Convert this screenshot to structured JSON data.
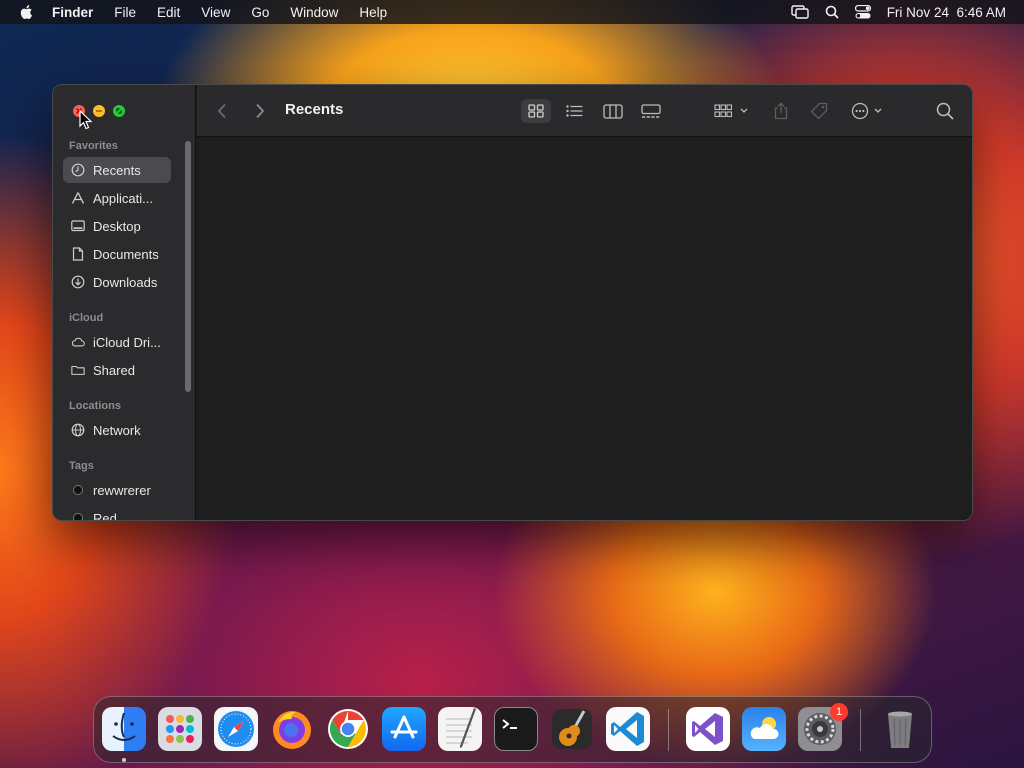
{
  "menubar": {
    "app_name": "Finder",
    "menus": [
      "File",
      "Edit",
      "View",
      "Go",
      "Window",
      "Help"
    ],
    "clock": "Fri Nov 24  6:46 AM",
    "icons": [
      "screen-mirroring-icon",
      "spotlight-search-icon",
      "control-center-icon"
    ]
  },
  "window": {
    "title": "Recents",
    "sidebar": {
      "sections": [
        {
          "label": "Favorites",
          "items": [
            {
              "label": "Recents",
              "icon": "clock-icon",
              "selected": true
            },
            {
              "label": "Applicati...",
              "icon": "applications-icon"
            },
            {
              "label": "Desktop",
              "icon": "desktop-icon"
            },
            {
              "label": "Documents",
              "icon": "document-icon"
            },
            {
              "label": "Downloads",
              "icon": "download-icon"
            }
          ]
        },
        {
          "label": "iCloud",
          "items": [
            {
              "label": "iCloud Dri...",
              "icon": "cloud-icon"
            },
            {
              "label": "Shared",
              "icon": "shared-folder-icon"
            }
          ]
        },
        {
          "label": "Locations",
          "items": [
            {
              "label": "Network",
              "icon": "globe-icon"
            }
          ]
        },
        {
          "label": "Tags",
          "items": [
            {
              "label": "rewwrerer",
              "icon": "tag-dot-icon"
            },
            {
              "label": "Red",
              "icon": "tag-dot-icon"
            }
          ]
        }
      ]
    },
    "toolbar": {
      "buttons": [
        "back-icon",
        "forward-icon",
        "icon-view-icon",
        "list-view-icon",
        "column-view-icon",
        "gallery-view-icon",
        "group-icon",
        "share-icon",
        "tag-icon",
        "more-actions-icon",
        "search-icon"
      ],
      "selected_view": "icon-view"
    }
  },
  "dock": {
    "apps": [
      {
        "name": "Finder",
        "running": true
      },
      {
        "name": "Launchpad"
      },
      {
        "name": "Safari"
      },
      {
        "name": "Firefox"
      },
      {
        "name": "Chrome"
      },
      {
        "name": "App Store"
      },
      {
        "name": "TextEdit"
      },
      {
        "name": "Terminal"
      },
      {
        "name": "GarageBand"
      },
      {
        "name": "Visual Studio Code"
      },
      {
        "name": "Visual Studio"
      },
      {
        "name": "Weather"
      },
      {
        "name": "System Settings",
        "badge": "1"
      },
      {
        "name": "Trash"
      }
    ]
  },
  "colors": {
    "close": "#ff5f57",
    "minimize": "#febc2e",
    "maximize": "#28c840",
    "badge": "#ff3b30"
  }
}
